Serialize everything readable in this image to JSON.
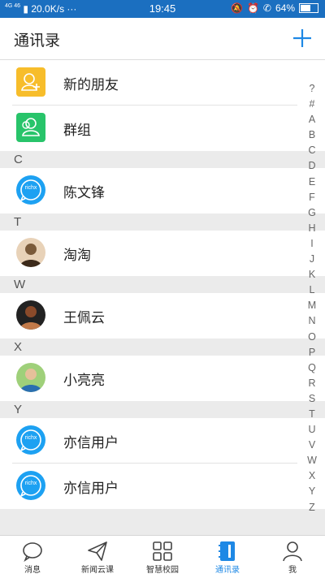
{
  "status_bar": {
    "network": "4G 46",
    "speed": "20.0K/s",
    "dots": "···",
    "time": "19:45",
    "battery": "64%",
    "battery_level": 0.64
  },
  "header": {
    "title": "通讯录"
  },
  "top_items": [
    {
      "label": "新的朋友",
      "icon": "add-friend-icon",
      "color": "#f7bd2b"
    },
    {
      "label": "群组",
      "icon": "group-icon",
      "color": "#28c46a"
    }
  ],
  "sections": [
    {
      "letter": "C",
      "contacts": [
        {
          "name": "陈文锋",
          "avatar": "richx-avatar"
        }
      ]
    },
    {
      "letter": "T",
      "contacts": [
        {
          "name": "淘淘",
          "avatar": "photo-avatar"
        }
      ]
    },
    {
      "letter": "W",
      "contacts": [
        {
          "name": "王佩云",
          "avatar": "photo-avatar"
        }
      ]
    },
    {
      "letter": "X",
      "contacts": [
        {
          "name": "小亮亮",
          "avatar": "photo-avatar"
        }
      ]
    },
    {
      "letter": "Y",
      "contacts": [
        {
          "name": "亦信用户",
          "avatar": "richx-avatar"
        },
        {
          "name": "亦信用户",
          "avatar": "richx-avatar"
        }
      ]
    }
  ],
  "avatar_logo_text": "richx",
  "index_letters": [
    "?",
    "#",
    "A",
    "B",
    "C",
    "D",
    "E",
    "F",
    "G",
    "H",
    "I",
    "J",
    "K",
    "L",
    "M",
    "N",
    "O",
    "P",
    "Q",
    "R",
    "S",
    "T",
    "U",
    "V",
    "W",
    "X",
    "Y",
    "Z"
  ],
  "tabs": [
    {
      "label": "消息",
      "icon": "chat-bubble-icon"
    },
    {
      "label": "新闻云课",
      "icon": "paper-plane-icon"
    },
    {
      "label": "智慧校园",
      "icon": "grid-icon"
    },
    {
      "label": "通讯录",
      "icon": "contacts-book-icon",
      "active": true
    },
    {
      "label": "我",
      "icon": "person-icon"
    }
  ],
  "colors": {
    "accent": "#1e88e5",
    "status_bar": "#1b6fc0",
    "richx_blue": "#1da1f2"
  }
}
